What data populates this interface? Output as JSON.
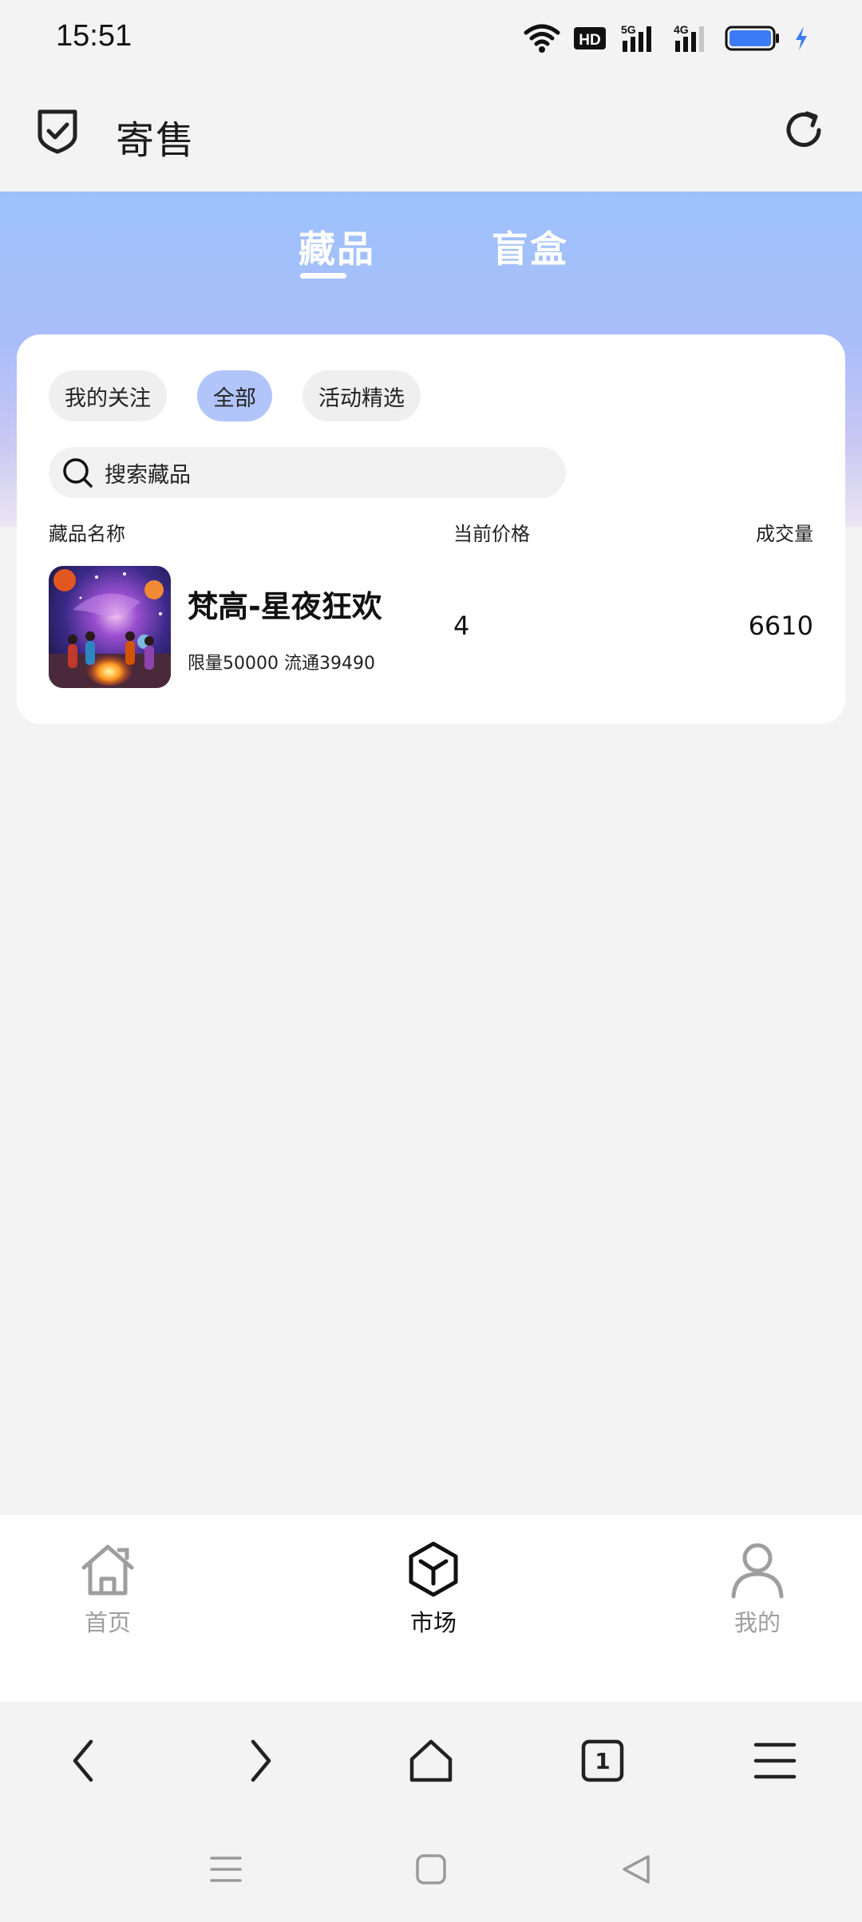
{
  "status_bar": {
    "time": "15:51",
    "hd_badge": "HD",
    "network_5g": "5G",
    "network_4g": "4G",
    "battery_color": "#3b7cf6",
    "icons": [
      "wifi-icon",
      "hd-icon",
      "signal-5g-icon",
      "signal-4g-icon",
      "battery-icon",
      "charging-icon"
    ]
  },
  "header": {
    "title": "寄售",
    "left_icon": "shield-check-icon",
    "right_icon": "refresh-icon"
  },
  "tabs": [
    {
      "label": "藏品",
      "active": true
    },
    {
      "label": "盲盒",
      "active": false
    }
  ],
  "filters": {
    "chips": [
      {
        "label": "我的关注",
        "active": false
      },
      {
        "label": "全部",
        "active": true
      },
      {
        "label": "活动精选",
        "active": false
      }
    ],
    "accent_color": "#b1c5fb"
  },
  "search": {
    "placeholder": "搜索藏品",
    "icon": "search-icon"
  },
  "table": {
    "headers": {
      "name": "藏品名称",
      "price": "当前价格",
      "volume": "成交量"
    },
    "rows": [
      {
        "name": "梵高-星夜狂欢",
        "meta": "限量50000 流通39490",
        "price": "4",
        "volume": "6610"
      }
    ]
  },
  "bottom_nav": {
    "items": [
      {
        "label": "首页",
        "icon": "home-icon",
        "active": false
      },
      {
        "label": "市场",
        "icon": "cube-icon",
        "active": true
      },
      {
        "label": "我的",
        "icon": "user-icon",
        "active": false
      }
    ]
  },
  "browser_bar": {
    "tab_count": "1",
    "icons": [
      "back-icon",
      "forward-icon",
      "home-icon",
      "tabs-icon",
      "menu-icon"
    ]
  },
  "system_nav": {
    "icons": [
      "recents-icon",
      "home-icon",
      "back-icon"
    ]
  }
}
